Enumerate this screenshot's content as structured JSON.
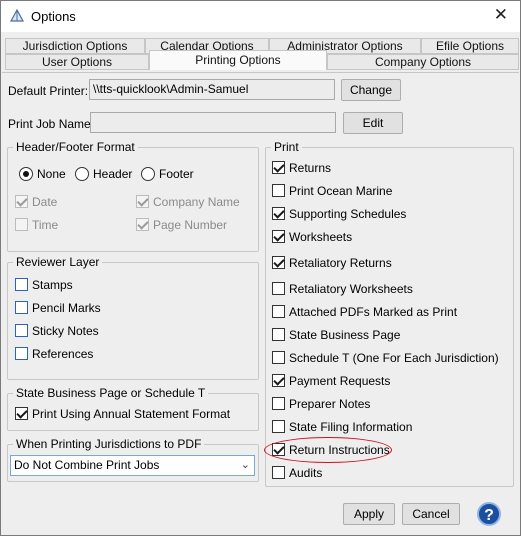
{
  "window": {
    "title": "Options"
  },
  "tabs": {
    "row1": [
      {
        "label": "Jurisdiction Options"
      },
      {
        "label": "Calendar Options"
      },
      {
        "label": "Administrator Options"
      },
      {
        "label": "Efile Options"
      }
    ],
    "row2": [
      {
        "label": "User Options"
      },
      {
        "label": "Printing Options"
      },
      {
        "label": "Company Options"
      }
    ]
  },
  "printer": {
    "default_label": "Default Printer:",
    "default_value": "\\\\tts-quicklook\\Admin-Samuel",
    "change_label": "Change",
    "job_label": "Print Job Name:",
    "job_value": "",
    "edit_label": "Edit"
  },
  "header_footer": {
    "title": "Header/Footer Format",
    "radios": [
      {
        "label": "None",
        "selected": true
      },
      {
        "label": "Header",
        "selected": false
      },
      {
        "label": "Footer",
        "selected": false
      }
    ],
    "options": [
      {
        "label": "Date",
        "checked": true
      },
      {
        "label": "Company Name",
        "checked": true
      },
      {
        "label": "Time",
        "checked": false
      },
      {
        "label": "Page Number",
        "checked": true
      }
    ]
  },
  "reviewer": {
    "title": "Reviewer Layer",
    "items": [
      {
        "label": "Stamps",
        "checked": false
      },
      {
        "label": "Pencil Marks",
        "checked": false
      },
      {
        "label": "Sticky Notes",
        "checked": false
      },
      {
        "label": "References",
        "checked": false
      }
    ]
  },
  "state_business": {
    "title": "State Business Page or Schedule T",
    "item": {
      "label": "Print Using Annual Statement Format",
      "checked": true
    }
  },
  "jurisdictions_pdf": {
    "title": "When Printing Jurisdictions to PDF",
    "selected": "Do Not Combine Print Jobs"
  },
  "print": {
    "title": "Print",
    "items": [
      {
        "label": "Returns",
        "checked": true
      },
      {
        "label": "Print Ocean Marine",
        "checked": false
      },
      {
        "label": "Supporting Schedules",
        "checked": true
      },
      {
        "label": "Worksheets",
        "checked": true
      },
      {
        "label": "Retaliatory Returns",
        "checked": true
      },
      {
        "label": "Retaliatory Worksheets",
        "checked": false
      },
      {
        "label": "Attached PDFs Marked as Print",
        "checked": false
      },
      {
        "label": "State Business Page",
        "checked": false
      },
      {
        "label": "Schedule T (One For Each Jurisdiction)",
        "checked": false
      },
      {
        "label": "Payment Requests",
        "checked": true
      },
      {
        "label": "Preparer Notes",
        "checked": false
      },
      {
        "label": "State Filing Information",
        "checked": false
      },
      {
        "label": "Return Instructions",
        "checked": true
      },
      {
        "label": "Audits",
        "checked": false
      }
    ]
  },
  "footer": {
    "apply_label": "Apply",
    "cancel_label": "Cancel",
    "help_glyph": "?"
  },
  "colors": {
    "highlight": "#d0121b",
    "help": "#1d4fa0"
  },
  "icons": [
    "app-icon",
    "close-icon",
    "chevron-down-icon",
    "help-icon"
  ]
}
